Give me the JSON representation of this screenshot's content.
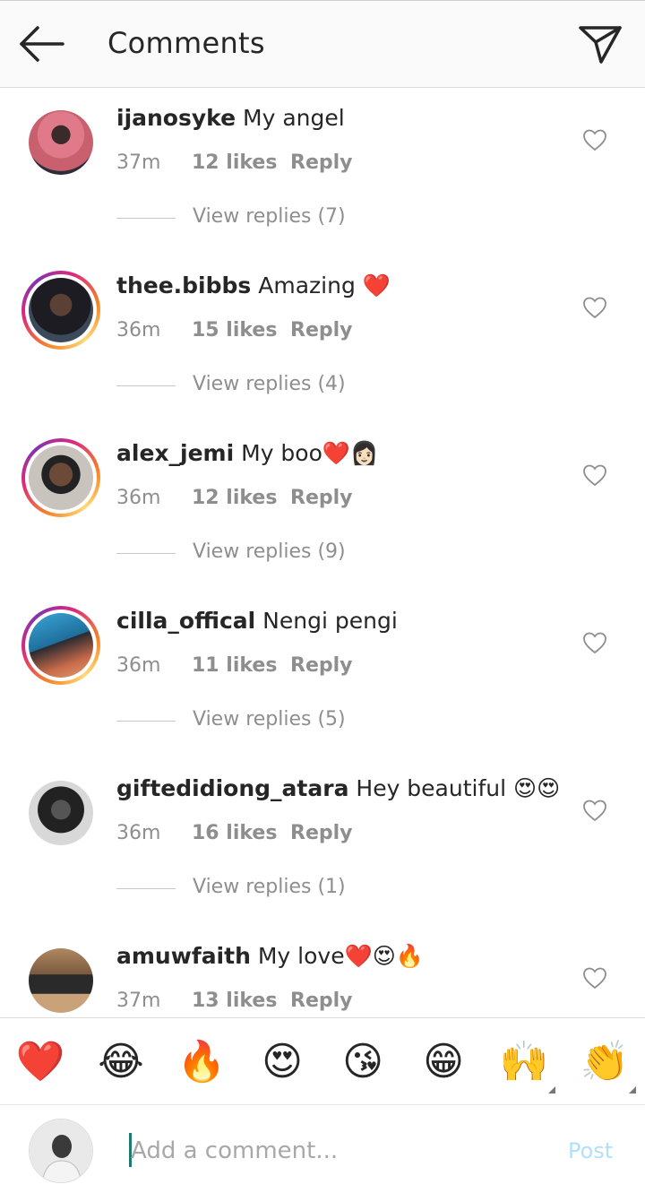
{
  "header": {
    "title": "Comments"
  },
  "comments": [
    {
      "username": "ijanosyke",
      "text": "My angel",
      "emojis": "",
      "time": "37m",
      "likes": "12 likes",
      "reply": "Reply",
      "view_replies": "View replies (7)"
    },
    {
      "username": "thee.bibbs",
      "text": "Amazing",
      "emojis": "❤️",
      "time": "36m",
      "likes": "15 likes",
      "reply": "Reply",
      "view_replies": "View replies (4)"
    },
    {
      "username": "alex_jemi",
      "text": "My boo",
      "emojis": "❤️👩🏻",
      "time": "36m",
      "likes": "12 likes",
      "reply": "Reply",
      "view_replies": "View replies (9)"
    },
    {
      "username": "cilla_offical",
      "text": "Nengi pengi",
      "emojis": "",
      "time": "36m",
      "likes": "11 likes",
      "reply": "Reply",
      "view_replies": "View replies (5)"
    },
    {
      "username": "giftedidiong_atara",
      "text": "Hey beautiful",
      "emojis": "😍😍",
      "time": "36m",
      "likes": "16 likes",
      "reply": "Reply",
      "view_replies": "View replies (1)"
    },
    {
      "username": "amuwfaith",
      "text": "My love",
      "emojis": "❤️😍🔥",
      "time": "37m",
      "likes": "13 likes",
      "reply": "Reply"
    }
  ],
  "emoji_bar": [
    "❤️",
    "😂",
    "🔥",
    "😍",
    "😘",
    "😁",
    "🙌",
    "👏"
  ],
  "composer": {
    "placeholder": "Add a comment...",
    "post_label": "Post"
  },
  "colors": {
    "accent_post": "#b2dffc",
    "meta_text": "#8e8e8e",
    "story_ring": "#dd2a7b"
  }
}
